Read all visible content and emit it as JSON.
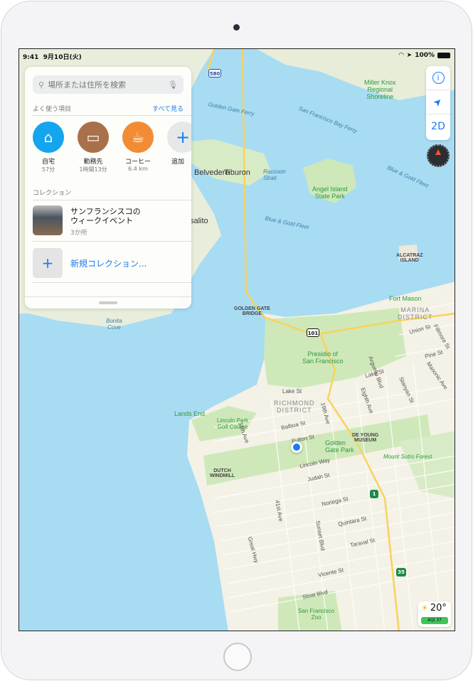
{
  "status_bar": {
    "time": "9:41",
    "date": "9月10日(火)",
    "battery": "100%"
  },
  "search": {
    "placeholder": "場所または住所を検索"
  },
  "favorites": {
    "title": "よく使う項目",
    "see_all": "すべて見る",
    "items": [
      {
        "name": "自宅",
        "detail": "57分",
        "icon": "home-icon",
        "color": "#14a5ef"
      },
      {
        "name": "勤務先",
        "detail": "1時間13分",
        "icon": "briefcase-icon",
        "color": "#a8714a"
      },
      {
        "name": "コーヒー",
        "detail": "6.4 km",
        "icon": "coffee-cup-icon",
        "color": "#f28c34"
      },
      {
        "name": "追加",
        "icon": "plus-icon"
      }
    ]
  },
  "collections": {
    "title": "コレクション",
    "items": [
      {
        "title_line1": "サンフランシスコの",
        "title_line2": "ウィークイベント",
        "count": "3か所"
      }
    ],
    "new_label": "新規コレクション..."
  },
  "map_controls": {
    "info": "i",
    "location": "location-arrow-icon",
    "view_mode": "2D",
    "compass": "compass-icon"
  },
  "weather": {
    "temp": "20°",
    "aqi": "AQI 37",
    "icon": "sun-icon"
  },
  "map_labels": {
    "tiburon": "Tiburon",
    "belvedere": "Belvedere",
    "sausalito": "salito",
    "raccoon": "Raccoon\nStrait",
    "angel": "Angel Island\nState Park",
    "gg_ferry": "Golden Gate Ferry",
    "sfbay_ferry": "San Francisco Bay Ferry",
    "blue_gold": "Blue & Gold Fleet",
    "blue_gold2": "Blue & Gold Fleet",
    "miller": "Miller Knox\nRegional\nShoreline",
    "alcatraz": "ALCATRAZ\nISLAND",
    "fort_mason": "Fort Mason",
    "marina": "MARINA\nDISTRICT",
    "union": "Union St",
    "fillmore": "Fillmore St",
    "pine": "Pine St",
    "ggbridge": "GOLDEN GATE\nBRIDGE",
    "presidio": "Presidio of\nSan Francisco",
    "richmond": "RICHMOND\nDISTRICT",
    "lake": "Lake St",
    "lake2": "Lake St",
    "lands_end": "Lands End",
    "lincoln_park": "Lincoln Park\nGolf Course",
    "balboa": "Balboa St",
    "fulton": "Fulton St",
    "ggpark": "Golden\nGate Park",
    "deyoung": "DE YOUNG\nMUSEUM",
    "lincoln_way": "Lincoln Way",
    "judah": "Judah St",
    "noriega": "Noriega St",
    "quintara": "Quintara St",
    "taraval": "Taraval St",
    "vicente": "Vicente St",
    "sloat": "Sloat Blvd",
    "zoo": "San Francisco\nZoo",
    "sutro": "Mount Sutro Forest",
    "windmill": "DUTCH\nWINDMILL",
    "bonita": "Bonita\nCove",
    "ave41": "41st Ave",
    "sunset": "Sunset Blvd",
    "great_hwy": "Great Hwy",
    "ave34": "34th Ave",
    "ave19": "19th Ave",
    "arguello": "Arguello Blvd",
    "stanyan": "Stanyan St",
    "masonic": "Masonic Ave",
    "eighth": "Eighth Ave",
    "hwy580": "580",
    "hwy101": "101",
    "hwy1": "1",
    "hwy35": "35"
  },
  "colors": {
    "water": "#a8dcf3",
    "land": "#f4f1e6",
    "park": "#cfe8b9",
    "road": "#f7d35c",
    "accent": "#1a7cf0"
  }
}
